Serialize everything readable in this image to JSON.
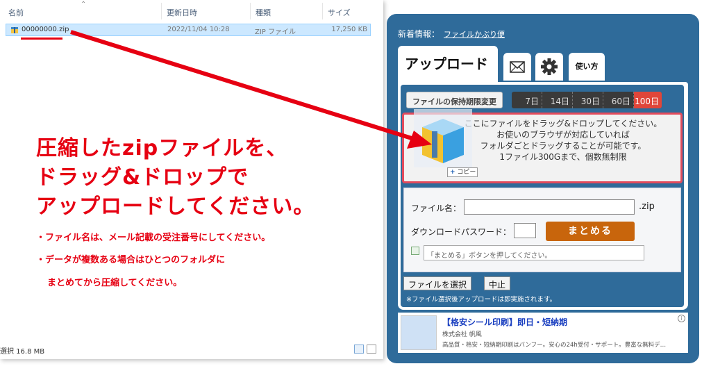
{
  "explorer": {
    "columns": {
      "name": "名前",
      "date": "更新日時",
      "type": "種類",
      "size": "サイズ"
    },
    "file": {
      "name": "00000000.zip",
      "date": "2022/11/04 10:28",
      "type": "ZIP ファイル",
      "size": "17,250 KB"
    },
    "status": "選択 16.8 MB"
  },
  "instructions": {
    "lines": [
      "圧縮したzipファイルを、",
      "ドラッグ&ドロップで",
      "アップロードしてください。"
    ],
    "notes": [
      "・ファイル名は、メール記載の受注番号にしてください。",
      "・データが複数ある場合はひとつのフォルダに",
      "まとめてから圧縮してください。"
    ]
  },
  "panel": {
    "news_label": "新着情報：",
    "news_link": "ファイルかぶり便",
    "tab_upload": "アップロード",
    "tab_howto": "使い方",
    "keep_label": "ファイルの保持期限変更",
    "days": [
      "7日",
      "14日",
      "30日",
      "60日",
      "100日"
    ],
    "selected_day": "100日",
    "dropzone": [
      "ここにファイルをドラッグ&ドロップしてください。",
      "お使いのブラウザが対応していれば",
      "フォルダごとドラッグすることが可能です。",
      "1ファイル300Gまで、個数無制限"
    ],
    "copy_tag": "コピー",
    "filename_label": "ファイル名：",
    "filename_value": "",
    "ext": ".zip",
    "password_label": "ダウンロードパスワード：",
    "password_value": "",
    "matome_button": "まとめる",
    "message": "「まとめる」ボタンを押してください。",
    "select_button": "ファイルを選択",
    "cancel_button": "中止",
    "note": "※ファイル選択後アップロードは即実施されます。"
  },
  "ad": {
    "title": "【格安シール印刷】即日・短納期",
    "company": "株式会社 帆風",
    "desc": "高品質・格安・短納期印刷はバンフー。安心の24h受付・サポート。豊富な無料デ…"
  },
  "colors": {
    "red": "#e60012",
    "panel": "#2f6b9a",
    "accent_orange": "#c8650c"
  }
}
